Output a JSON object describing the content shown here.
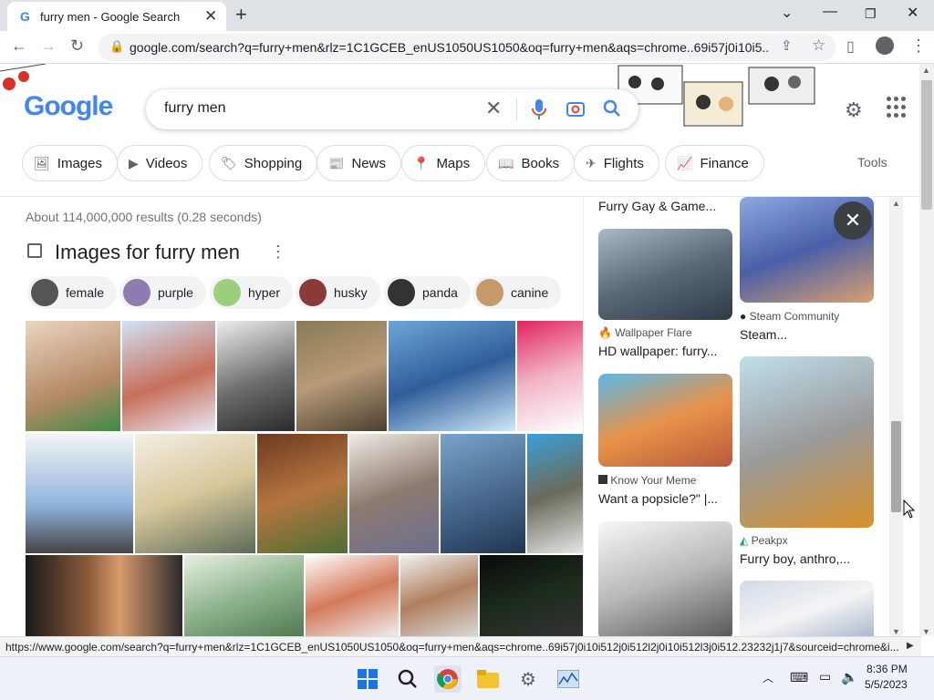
{
  "browser": {
    "tab_title": "furry men - Google Search",
    "address": "google.com/search?q=furry+men&rlz=1C1GCEB_enUS1050US1050&oq=furry+men&aqs=chrome..69i57j0i10i5...",
    "status_url": "https://www.google.com/search?q=furry+men&rlz=1C1GCEB_enUS1050US1050&oq=furry+men&aqs=chrome..69i57j0i10i512j0i512l2j0i10i512l3j0i512.23232j1j7&sourceid=chrome&i..."
  },
  "google": {
    "logo_text": "Google",
    "query": "furry men",
    "chips": [
      "Images",
      "Videos",
      "Shopping",
      "News",
      "Maps",
      "Books",
      "Flights",
      "Finance"
    ],
    "tools": "Tools"
  },
  "results": {
    "stats": "About 114,000,000 results (0.28 seconds)",
    "images_heading": "Images for furry men",
    "refinements": [
      "female",
      "purple",
      "hyper",
      "husky",
      "panda",
      "canine"
    ]
  },
  "panel": {
    "col1": [
      {
        "title": "Furry Gay & Game..."
      },
      {
        "source": "Wallpaper Flare",
        "title": "HD wallpaper: furry..."
      },
      {
        "source": "Know Your Meme",
        "title": "Want a popsicle?\" |..."
      }
    ],
    "col2": [
      {
        "source": "Steam Community",
        "title": "Steam..."
      },
      {
        "source": "Peakpx",
        "title": "Furry boy, anthro,..."
      }
    ]
  },
  "taskbar": {
    "time": "8:36 PM",
    "date": "5/5/2023"
  }
}
